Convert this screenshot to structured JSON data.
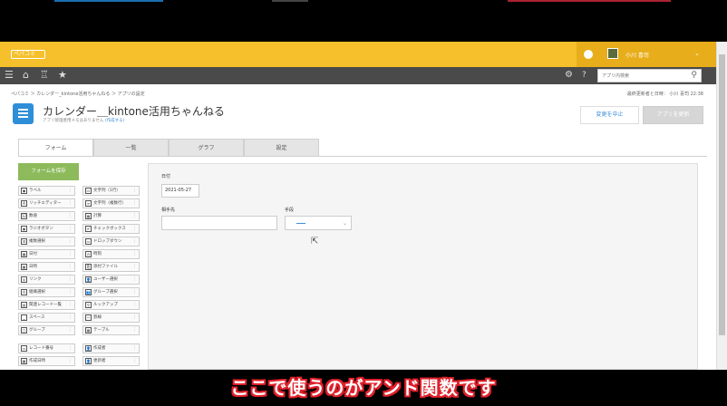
{
  "header": {
    "logo_text": "ペパコミ",
    "user_name": "小川 喜司",
    "search_placeholder": "アプリ内検索"
  },
  "breadcrumb": "ペパコミ ＞ カレンダー_kintone活用ちゃんねる ＞ アプリの設定",
  "last_updated": "最終更新者と日時： 小川 喜司 22:38",
  "app": {
    "title": "カレンダー＿kintone活用ちゃんねる",
    "memo": "アプリ管理者用メモはありません",
    "memo_link": "(作成する)"
  },
  "buttons": {
    "cancel": "変更を中止",
    "update": "アプリを更新",
    "save_form": "フォームを保存"
  },
  "tabs": [
    "フォーム",
    "一覧",
    "グラフ",
    "設定"
  ],
  "palette_left": [
    {
      "label": "ラベル",
      "icon": "◆"
    },
    {
      "label": "リッチエディター",
      "icon": "A"
    },
    {
      "label": "数値",
      "icon": "12"
    },
    {
      "label": "ラジオボタン",
      "icon": "◉"
    },
    {
      "label": "複数選択",
      "icon": "☰"
    },
    {
      "label": "日付",
      "icon": "▦"
    },
    {
      "label": "日時",
      "icon": "▦"
    },
    {
      "label": "リンク",
      "icon": "◎"
    },
    {
      "label": "組織選択",
      "icon": "⁂"
    },
    {
      "label": "関連レコード一覧",
      "icon": "▤"
    },
    {
      "label": "スペース",
      "icon": "⎵"
    },
    {
      "label": "グループ",
      "icon": "▢"
    },
    {
      "label": "レコード番号",
      "icon": "▭"
    },
    {
      "label": "作成日時",
      "icon": "▦"
    }
  ],
  "palette_right": [
    {
      "label": "文字列（1行）",
      "icon": "▭"
    },
    {
      "label": "文字列（複数行）",
      "icon": "≡"
    },
    {
      "label": "計算",
      "icon": "▦"
    },
    {
      "label": "チェックボックス",
      "icon": "✔"
    },
    {
      "label": "ドロップダウン",
      "icon": "▭"
    },
    {
      "label": "時刻",
      "icon": "◷"
    },
    {
      "label": "添付ファイル",
      "icon": "⎘"
    },
    {
      "label": "ユーザー選択",
      "icon": "👤"
    },
    {
      "label": "グループ選択",
      "icon": "👥"
    },
    {
      "label": "ルックアップ",
      "icon": "⚲"
    },
    {
      "label": "罫線",
      "icon": "—"
    },
    {
      "label": "テーブル",
      "icon": "▦"
    },
    {
      "label": "作成者",
      "icon": "👤"
    },
    {
      "label": "更新者",
      "icon": "👤"
    }
  ],
  "form": {
    "date_label": "日付",
    "date_value": "2021-05-27",
    "partner_label": "相手先",
    "method_label": "手段"
  },
  "subtitle": "ここで使うのがアンド関数です"
}
